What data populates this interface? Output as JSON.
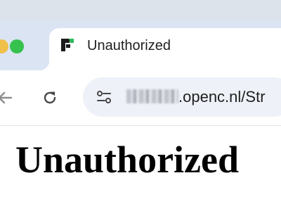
{
  "tab": {
    "title": "Unauthorized",
    "favicon": "app-logo-icon"
  },
  "toolbar": {
    "back_icon": "arrow-left-icon",
    "reload_icon": "reload-icon",
    "site_info_icon": "tune-icon"
  },
  "address_bar": {
    "url_visible": ".openc.nl/Str"
  },
  "page": {
    "heading": "Unauthorized"
  },
  "colors": {
    "tabstrip_bg": "#dbe4f3",
    "omnibox_bg": "#eef1f8",
    "favicon_green": "#2fb85a",
    "traffic_green": "#36c24d",
    "traffic_yellow": "#f0c14a"
  }
}
